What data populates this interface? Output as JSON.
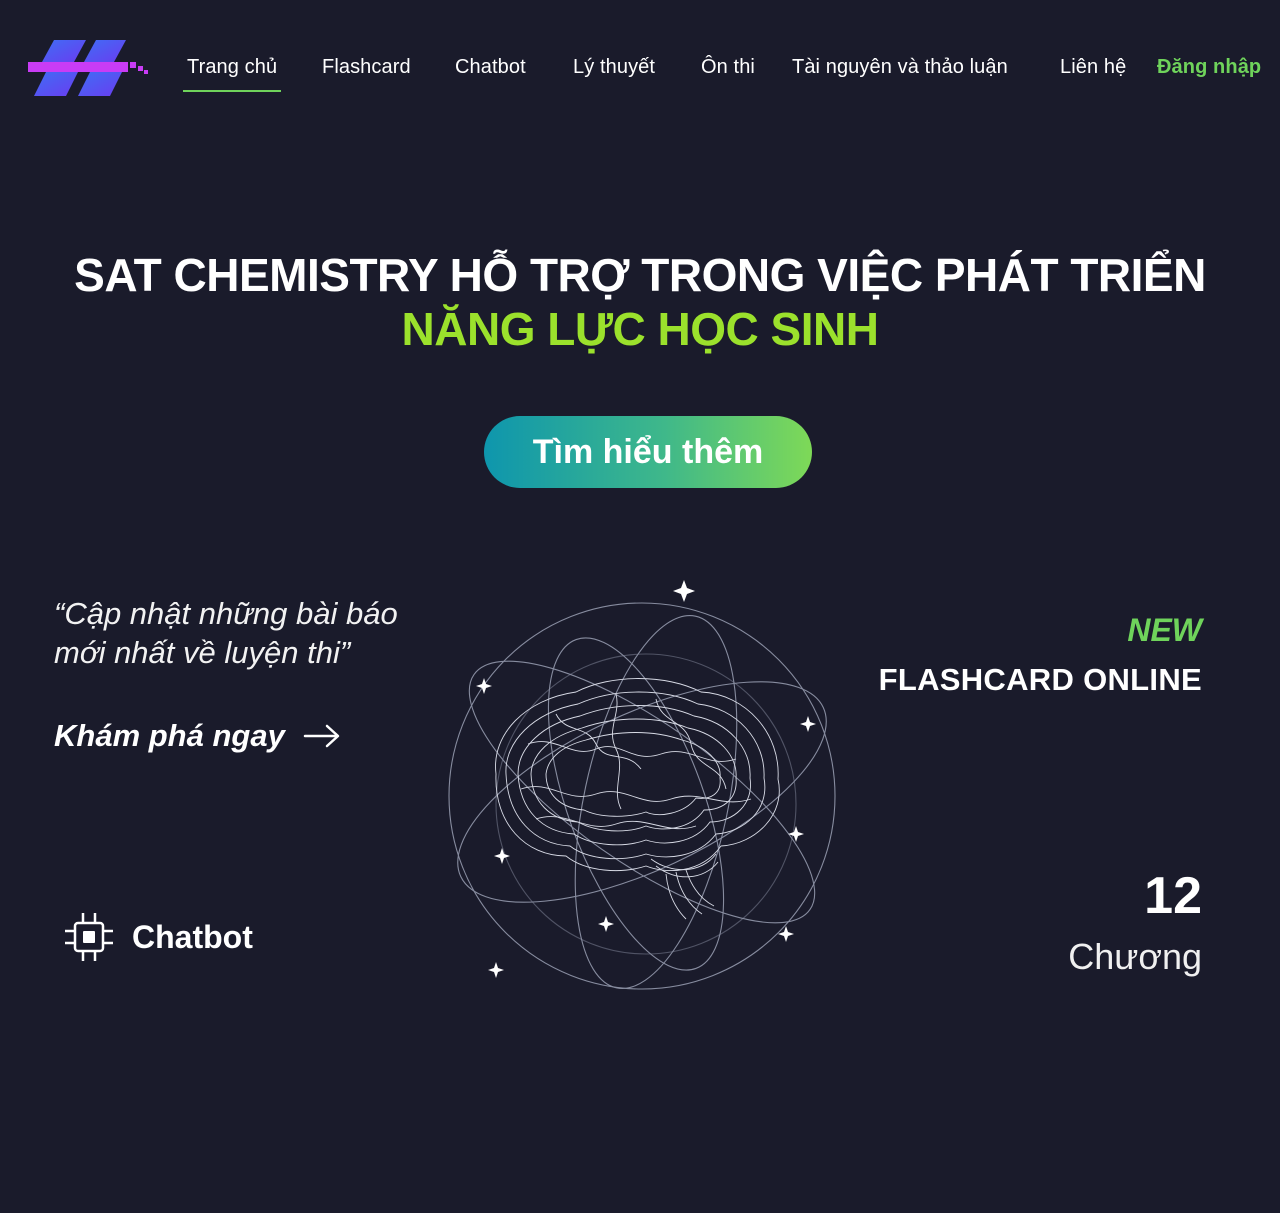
{
  "nav": {
    "links": [
      {
        "label": "Trang chủ",
        "active": true
      },
      {
        "label": "Flashcard"
      },
      {
        "label": "Chatbot"
      },
      {
        "label": "Lý thuyết"
      },
      {
        "label": "Ôn thi"
      },
      {
        "label": "Tài nguyên và thảo luận"
      },
      {
        "label": "Liên hệ"
      }
    ],
    "login_label": "Đăng nhập",
    "logo_icon": "brand-logo-icon"
  },
  "hero": {
    "title_line1": "SAT CHEMISTRY HỖ TRỢ TRONG VIỆC PHÁT TRIỂN",
    "title_line2": "NĂNG LỰC HỌC SINH",
    "cta_label": "Tìm hiểu thêm"
  },
  "left": {
    "quote": "“Cập nhật những bài báo mới nhất về luyện thi”",
    "explore_label": "Khám phá ngay",
    "chatbot_label": "Chatbot",
    "chatbot_icon": "chip-icon"
  },
  "right": {
    "new_label": "NEW",
    "flashcard_label": "FLASHCARD ONLINE",
    "chapter_count": "12",
    "chapter_label": "Chương"
  },
  "illustration": {
    "icon": "brain-orbit-illustration"
  },
  "colors": {
    "background": "#1a1b2b",
    "accent_green": "#6fd35b",
    "hero_green": "#9be12c",
    "cta_gradient_start": "#0e96ad",
    "cta_gradient_end": "#7ed957"
  }
}
